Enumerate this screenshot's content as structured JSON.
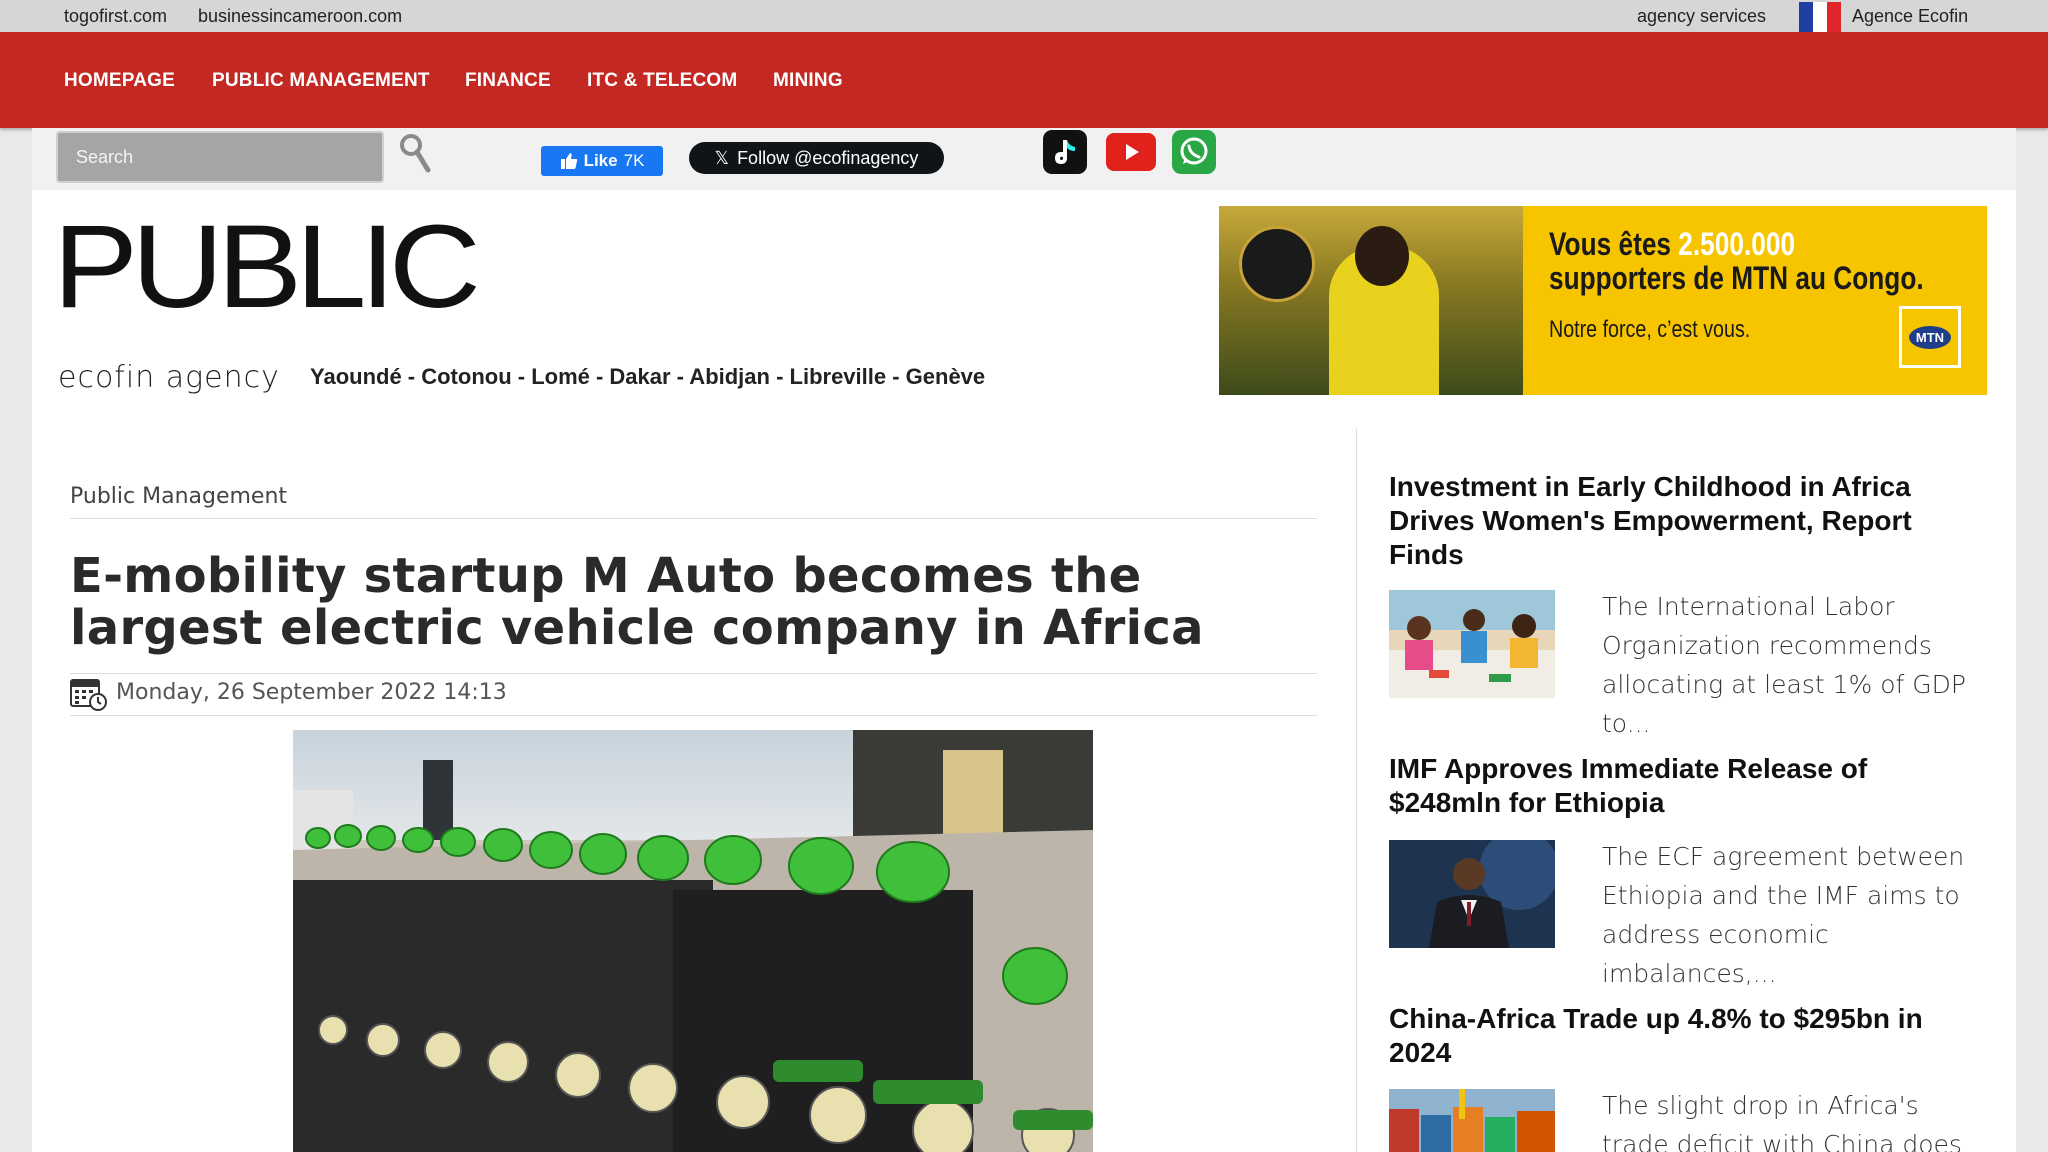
{
  "topbar": {
    "links": [
      "togofirst.com",
      "businessincameroon.com"
    ],
    "agency_services": "agency services",
    "agency_name": "Agence Ecofin"
  },
  "nav": {
    "items": [
      "HOMEPAGE",
      "PUBLIC MANAGEMENT",
      "FINANCE",
      "ITC & TELECOM",
      "MINING"
    ]
  },
  "toolbar": {
    "search_placeholder": "Search",
    "fb_like": "Like",
    "fb_count": "7K",
    "x_follow": "Follow @ecofinagency"
  },
  "masthead": {
    "logo": "PUBLIC",
    "sublogo": "ecofin agency",
    "cities": "Yaoundé - Cotonou - Lomé - Dakar - Abidjan - Libreville - Genève"
  },
  "ad": {
    "line1_a": "Vous êtes ",
    "line1_b": "2.500.000",
    "line2": "supporters de MTN au Congo.",
    "line3": "Notre force, c’est vous.",
    "brand": "MTN"
  },
  "article": {
    "category": "Public Management",
    "title": "E-mobility startup M Auto becomes the largest electric vehicle company in Africa",
    "date": "Monday, 26 September 2022 14:13"
  },
  "sidebar": {
    "items": [
      {
        "title": "Investment in Early Childhood in Africa Drives Women's Empowerment, Report Finds",
        "excerpt": "The International Labor Organization recommends allocating at least 1% of GDP to..."
      },
      {
        "title": "IMF Approves Immediate Release of $248mln for Ethiopia",
        "excerpt": "The ECF agreement between Ethiopia and the IMF aims to address economic imbalances,..."
      },
      {
        "title": "China-Africa Trade up 4.8% to $295bn in 2024",
        "excerpt": "The slight drop in Africa's trade deficit with China does not show"
      }
    ]
  },
  "colors": {
    "nav_red": "#c32822",
    "fb_blue": "#1877f2",
    "x_black": "#0f1419",
    "mtn_yellow": "#f7c400"
  }
}
